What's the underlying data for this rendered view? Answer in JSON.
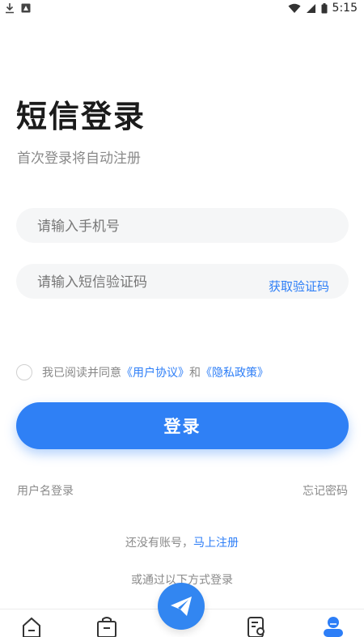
{
  "status_bar": {
    "time": "5:15"
  },
  "page": {
    "title": "短信登录",
    "subtitle": "首次登录将自动注册"
  },
  "phone_input": {
    "placeholder": "请输入手机号"
  },
  "code_input": {
    "placeholder": "请输入短信验证码",
    "get_code_label": "获取验证码"
  },
  "agreement": {
    "prefix": "我已阅读并同意",
    "user_agreement": "《用户协议》",
    "and": "和",
    "privacy_policy": "《隐私政策》"
  },
  "login_button": {
    "label": "登录"
  },
  "options": {
    "username_login": "用户名登录",
    "forgot_password": "忘记密码"
  },
  "register": {
    "prompt": "还没有账号，",
    "link": "马上注册"
  },
  "other_methods": "或通过以下方式登录",
  "bottom_nav": {
    "icons": [
      "home-icon",
      "bag-icon",
      "send-icon",
      "document-search-icon",
      "user-icon"
    ],
    "active_color": "#2d7ef7"
  },
  "colors": {
    "accent": "#2f80f5",
    "link": "#2d7ef7"
  }
}
